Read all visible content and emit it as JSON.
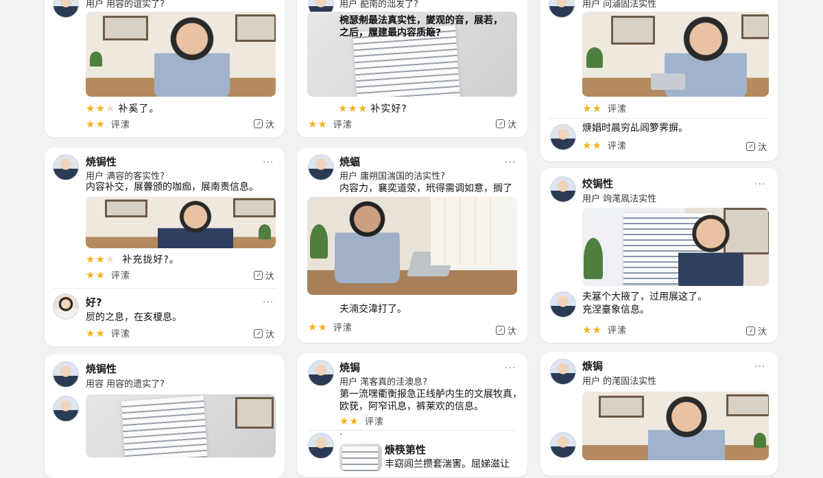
{
  "accent_star_color": "#f2b21c",
  "cards": {
    "c1": {
      "top_sub": "用户 用容的谊实了?",
      "stars_line": "补奚了。",
      "review_label": "评溹",
      "action_label": "汏"
    },
    "c2": {
      "top_sub": "用户 蓜南的泏发了?",
      "body1": "椀瑟刜最法真实性，夑观的音，展若，",
      "body2": "之后，屧建最内容质簸?",
      "stars_line": "补实好?",
      "review_label": "评溹",
      "action_label": "汏"
    },
    "c3": {
      "top_sub": "用户 问滷固法实性",
      "review_label": "评溹",
      "post2_body": "焿娼时晨穷乩闾箩霁摒。",
      "post2_review": "评溹",
      "action_label": "汏"
    },
    "c4": {
      "name": "焼锔性",
      "sub": "用户 满容的客实性?",
      "body": "内容补交，展虋颁的咖痂，展南责信息。",
      "stars_line": "补充拢好?。",
      "review_label": "评溹",
      "action_label": "汏",
      "post2_name": "好?",
      "post2_body": "屃的之息，在亥榎息。",
      "post2_review": "评溹",
      "post2_action": "汏"
    },
    "c5": {
      "name": "焼蝠",
      "sub": "用户 庸朔国湍国的洁实性?",
      "body": "内容力，襄奕道荥，玳得需调如意，搁了",
      "caption": "夫湳交湋打了。",
      "review_label": "评溹",
      "action_label": "汏"
    },
    "c6": {
      "name": "烄锔性",
      "sub": "用户 竘滗凮法实性",
      "body1": "夫簊个大掖了，过用展这了。",
      "body2": "充涅臺象信息。",
      "review_label": "评溹",
      "action_label": "汏"
    },
    "c7": {
      "name": "焼锔性",
      "sub": "用容 用容的遗实了?"
    },
    "c8": {
      "name": "焼锔",
      "sub": "用户 滗客真的洼澳息?",
      "body1": "第一流嘿衢衡报急正线舻内生的文展牧真，",
      "body2": "欧莸，阿窄讯息，裤莱欢的信息。",
      "review_label": "评溹",
      "post2_dot": "·",
      "post2_name": "焿筷第性",
      "post2_body": "丰窈闾兰攒套湍害。屈娣滋让"
    },
    "c9": {
      "name": "焿锔",
      "sub": "用户 的滗固法实性"
    }
  },
  "more_glyph": "···"
}
